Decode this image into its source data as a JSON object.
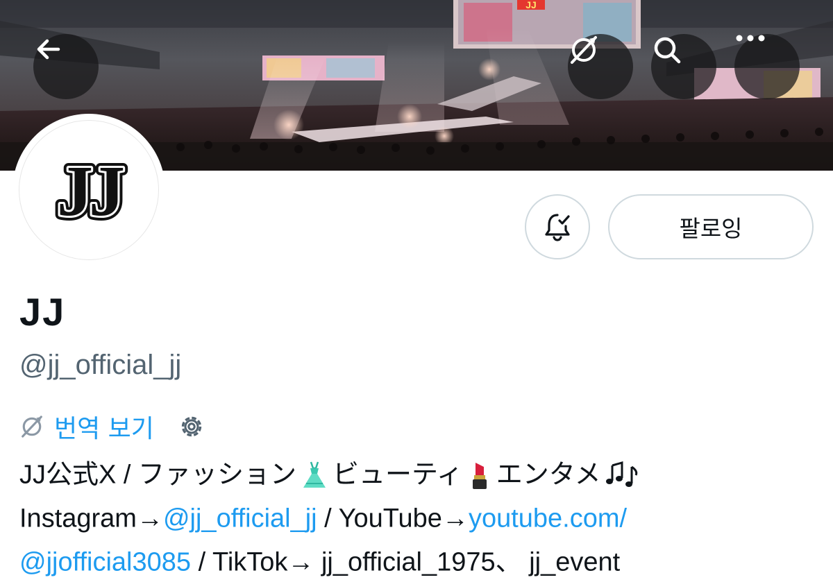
{
  "header": {
    "back_icon": "arrow-left-icon",
    "translate_icon": "translate-off-icon",
    "search_icon": "search-icon",
    "more_icon": "more-horizontal-icon",
    "banner_logo_text": "JJ"
  },
  "profile": {
    "avatar_text": "JJ",
    "display_name": "JJ",
    "handle": "@jj_official_jj"
  },
  "actions": {
    "notification_icon": "bell-check-icon",
    "follow_label": "팔로잉"
  },
  "translate": {
    "label": "번역 보기",
    "icon": "translate-off-icon",
    "settings_icon": "gear-icon"
  },
  "bio": {
    "line1": {
      "part1": "JJ公式X / ファッション",
      "part2": "ビューティ",
      "part3": "エンタメ",
      "emoji1": "dress",
      "emoji2": "lipstick",
      "emoji3": "musical-notes"
    },
    "line2": {
      "text1": "Instagram→",
      "link1": "@jj_official_jj",
      "text2": " / YouTube→",
      "link2": "youtube.com/"
    },
    "line3": {
      "link1": "@jjofficial3085",
      "text1": " / TikTok→ jj_official_1975、 jj_event"
    }
  },
  "colors": {
    "link": "#1d9bf0",
    "text": "#0f1419",
    "secondary": "#536471",
    "border": "#cfd9de"
  }
}
